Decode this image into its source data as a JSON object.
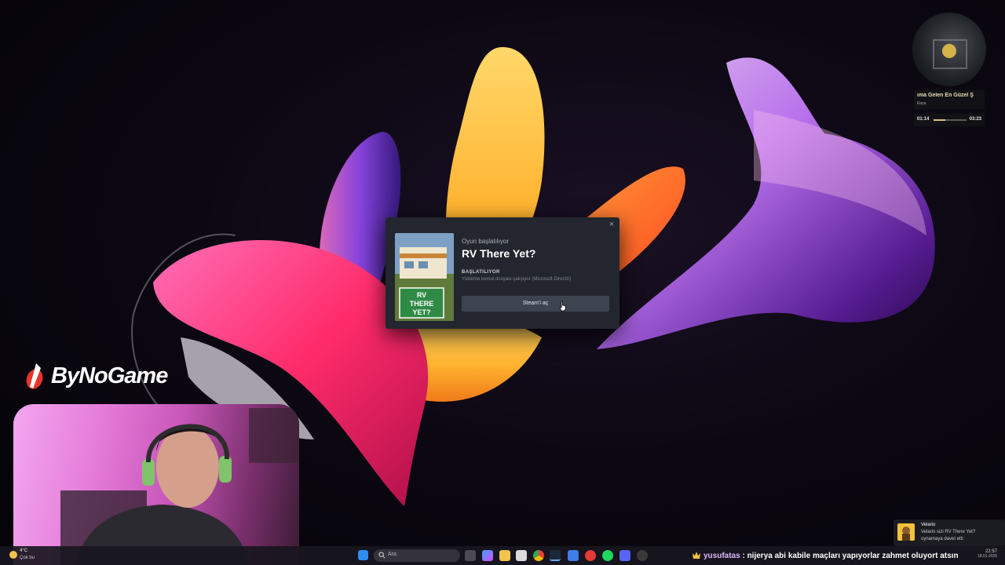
{
  "dialog": {
    "close_glyph": "×",
    "status_small": "Oyun başlatılıyor",
    "game_title": "RV There Yet?",
    "phase": "BAŞLATILIYOR",
    "detail": "Yükleme komut dosyası çalışıyor (Microsoft DirectX)",
    "open_steam_button": "Steam'i aç",
    "cover_text": [
      "RV",
      "THERE",
      "YET?"
    ]
  },
  "logo": {
    "text": "ByNoGame"
  },
  "music": {
    "song_title": "ıma Gelen En Güzel Ş",
    "artist": "Koyu",
    "elapsed": "01:14",
    "duration": "03:23",
    "progress": 0.36
  },
  "taskbar": {
    "search_placeholder": "Ara",
    "weather_temp": "4°C",
    "weather_desc": "Çok bu",
    "time": "22:57",
    "date": "18.01.2026",
    "icons": [
      "windows-start-icon",
      "search-icon",
      "task-view-icon",
      "copilot-icon",
      "file-explorer-icon",
      "calendar-app-icon",
      "chrome-icon",
      "steam-icon",
      "mail-icon",
      "youtube-icon",
      "spotify-icon",
      "discord-icon",
      "obs-icon"
    ]
  },
  "chat": {
    "username": "yusufatas",
    "separator": " : ",
    "message": "nijerya abi kabile maçları yapıyorlar zahmet oluyort atsın"
  },
  "notification": {
    "sender": "Velario",
    "line1": "Velario sizi RV There Yet?",
    "line2": "oynamaya davet etti"
  },
  "colors": {
    "dialog_bg": "#23262e",
    "button_bg": "#3d4450",
    "chat_username": "#e0b6ff",
    "accent_gold": "#d8c27a"
  }
}
